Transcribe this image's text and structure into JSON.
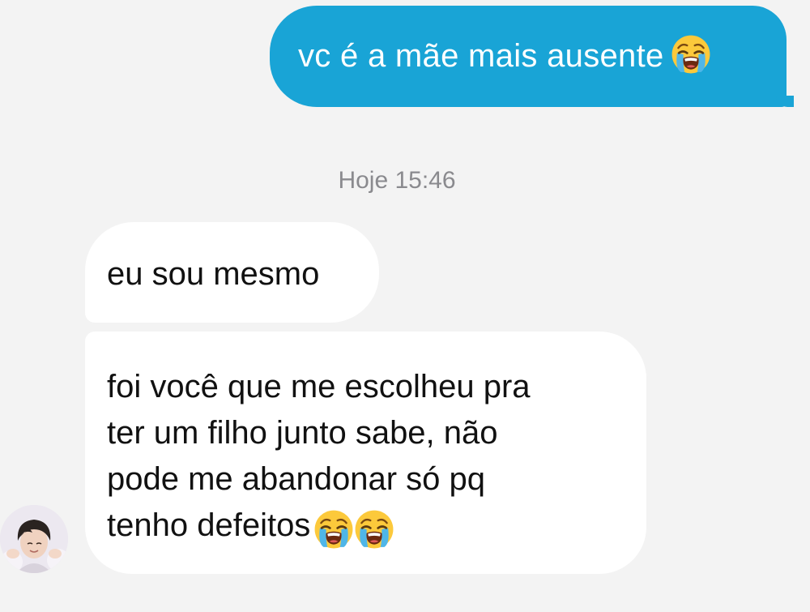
{
  "messages": {
    "sent_1": {
      "text": "vc é a mãe mais ausente",
      "emoji": "loudly-crying-face"
    },
    "timestamp": "Hoje 15:46",
    "received_1": {
      "text": "eu sou mesmo"
    },
    "received_2": {
      "text": "foi você que me escolheu pra\nter um filho junto sabe, não\npode me abandonar só pq\ntenho defeitos",
      "emojis": [
        "loudly-crying-face",
        "loudly-crying-face"
      ]
    }
  },
  "colors": {
    "background": "#f3f3f3",
    "sent_bubble": "#19a4d6",
    "received_bubble": "#ffffff",
    "timestamp": "#8a8a8e"
  },
  "avatar": {
    "icon": "profile-photo"
  }
}
